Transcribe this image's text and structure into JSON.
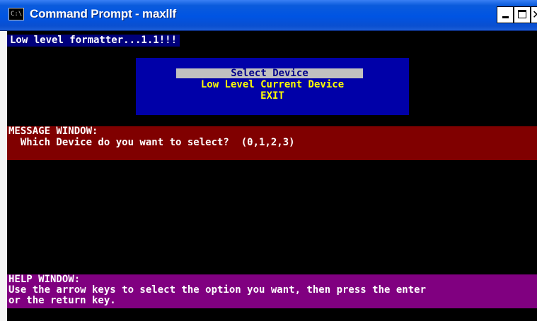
{
  "window": {
    "title": "Command Prompt - maxllf",
    "icon_text": "C:\\",
    "buttons": {
      "minimize": "minimize",
      "maximize": "maximize",
      "close": "✕"
    }
  },
  "console": {
    "header": "Low level formatter...1.1!!!",
    "menu": {
      "items": [
        {
          "label": "Select Device",
          "selected": true
        },
        {
          "label": "Low Level Current Device",
          "selected": false
        },
        {
          "label": "EXIT",
          "selected": false
        }
      ]
    },
    "message_window": {
      "title": "MESSAGE WINDOW:",
      "text": "  Which Device do you want to select?  (0,1,2,3)"
    },
    "help_window": {
      "title": "HELP WINDOW:",
      "line1": "Use the arrow keys to select the option you want, then press the enter",
      "line2": "or the return key."
    }
  },
  "colors": {
    "titlebar": "#0054e3",
    "console_bg": "#000000",
    "menu_bg": "#0000a8",
    "menu_text": "#ffff00",
    "menu_selected_bg": "#c0c0c0",
    "message_bg": "#800000",
    "help_bg": "#800080"
  }
}
